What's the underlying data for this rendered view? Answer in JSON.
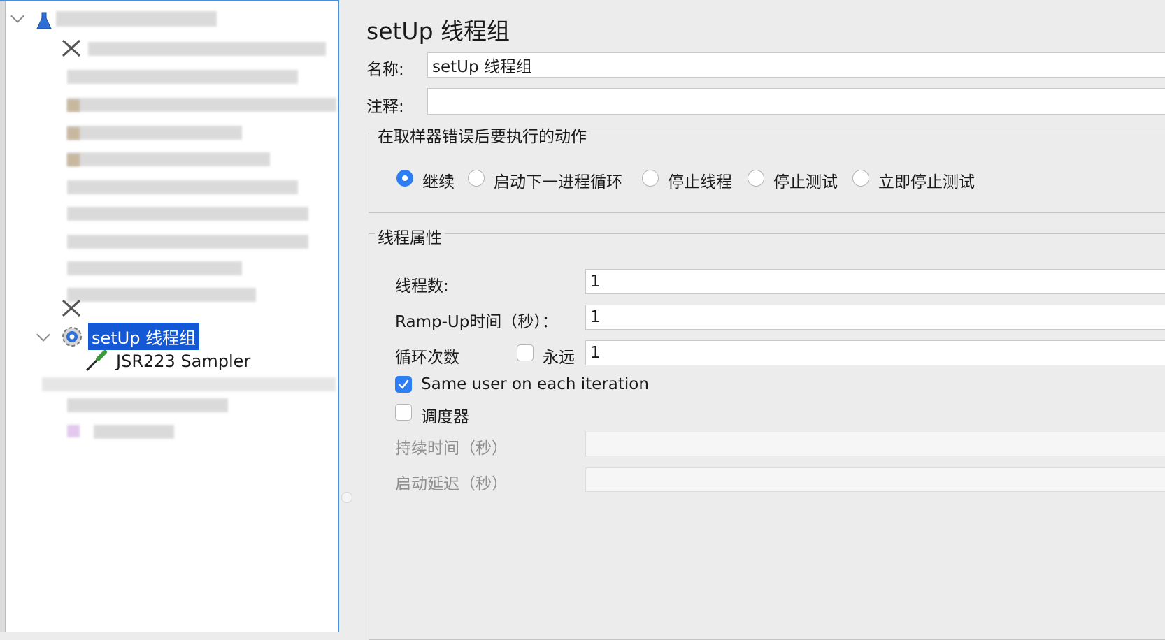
{
  "tree": {
    "selected_label": "setUp 线程组",
    "child_label": "JSR223 Sampler"
  },
  "panel": {
    "title": "setUp 线程组",
    "name_label": "名称:",
    "name_value": "setUp 线程组",
    "comment_label": "注释:",
    "comment_value": "",
    "error_action": {
      "group_title": "在取样器错误后要执行的动作",
      "options": [
        {
          "label": "继续",
          "selected": true
        },
        {
          "label": "启动下一进程循环",
          "selected": false
        },
        {
          "label": "停止线程",
          "selected": false
        },
        {
          "label": "停止测试",
          "selected": false
        },
        {
          "label": "立即停止测试",
          "selected": false
        }
      ]
    },
    "thread_props": {
      "group_title": "线程属性",
      "threads_label": "线程数:",
      "threads_value": "1",
      "rampup_label": "Ramp-Up时间（秒）：",
      "rampup_value": "1",
      "loop_label": "循环次数",
      "forever_label": "永远",
      "forever_checked": false,
      "loop_value": "1",
      "same_user_label": "Same user on each iteration",
      "same_user_checked": true,
      "scheduler_label": "调度器",
      "scheduler_checked": false,
      "duration_label": "持续时间（秒）",
      "duration_value": "",
      "delay_label": "启动延迟（秒）",
      "delay_value": ""
    }
  },
  "colors": {
    "accent": "#2c7ef2",
    "selection": "#1558d6",
    "tree_border": "#4a90d9"
  }
}
